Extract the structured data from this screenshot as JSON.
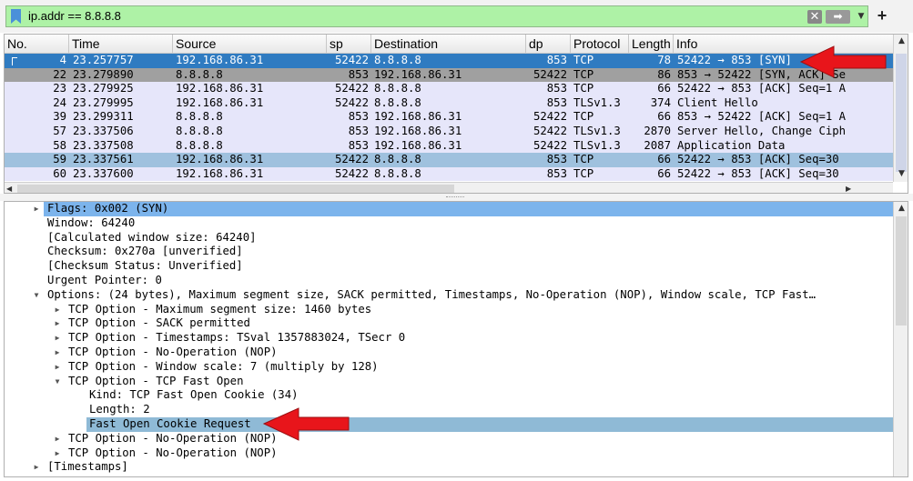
{
  "filter": {
    "value": "ip.addr == 8.8.8.8",
    "add_label": "+",
    "clear_glyph": "✕",
    "apply_glyph": "➡",
    "dropdown_glyph": "▼"
  },
  "packet_list": {
    "columns": [
      "No.",
      "Time",
      "Source",
      "sp",
      "Destination",
      "dp",
      "Protocol",
      "Length",
      "Info"
    ],
    "rows": [
      {
        "no": "4",
        "time": "23.257757",
        "source": "192.168.86.31",
        "sp": "52422",
        "destination": "8.8.8.8",
        "dp": "853",
        "protocol": "TCP",
        "length": "78",
        "info": "52422 → 853 [SYN]",
        "style": "selected"
      },
      {
        "no": "22",
        "time": "23.279890",
        "source": "8.8.8.8",
        "sp": "853",
        "destination": "192.168.86.31",
        "dp": "52422",
        "protocol": "TCP",
        "length": "86",
        "info": "853 → 52422 [SYN, ACK] Se",
        "style": "gray"
      },
      {
        "no": "23",
        "time": "23.279925",
        "source": "192.168.86.31",
        "sp": "52422",
        "destination": "8.8.8.8",
        "dp": "853",
        "protocol": "TCP",
        "length": "66",
        "info": "52422 → 853 [ACK] Seq=1 A",
        "style": "lavender"
      },
      {
        "no": "24",
        "time": "23.279995",
        "source": "192.168.86.31",
        "sp": "52422",
        "destination": "8.8.8.8",
        "dp": "853",
        "protocol": "TLSv1.3",
        "length": "374",
        "info": "Client Hello",
        "style": "lavender"
      },
      {
        "no": "39",
        "time": "23.299311",
        "source": "8.8.8.8",
        "sp": "853",
        "destination": "192.168.86.31",
        "dp": "52422",
        "protocol": "TCP",
        "length": "66",
        "info": "853 → 52422 [ACK] Seq=1 A",
        "style": "lavender"
      },
      {
        "no": "57",
        "time": "23.337506",
        "source": "8.8.8.8",
        "sp": "853",
        "destination": "192.168.86.31",
        "dp": "52422",
        "protocol": "TLSv1.3",
        "length": "2870",
        "info": "Server Hello, Change Ciph",
        "style": "lavender"
      },
      {
        "no": "58",
        "time": "23.337508",
        "source": "8.8.8.8",
        "sp": "853",
        "destination": "192.168.86.31",
        "dp": "52422",
        "protocol": "TLSv1.3",
        "length": "2087",
        "info": "Application Data",
        "style": "lavender"
      },
      {
        "no": "59",
        "time": "23.337561",
        "source": "192.168.86.31",
        "sp": "52422",
        "destination": "8.8.8.8",
        "dp": "853",
        "protocol": "TCP",
        "length": "66",
        "info": "52422 → 853 [ACK] Seq=30",
        "style": "blue"
      },
      {
        "no": "60",
        "time": "23.337600",
        "source": "192.168.86.31",
        "sp": "52422",
        "destination": "8.8.8.8",
        "dp": "853",
        "protocol": "TCP",
        "length": "66",
        "info": "52422 → 853 [ACK] Seq=30",
        "style": "lavender"
      }
    ]
  },
  "details": {
    "rows": [
      {
        "text": "Flags: 0x002 (SYN)",
        "level": 0,
        "caret": "collapsed",
        "style": "selected"
      },
      {
        "text": "Window: 64240",
        "level": 0,
        "caret": "none",
        "style": "normal"
      },
      {
        "text": "[Calculated window size: 64240]",
        "level": 0,
        "caret": "none",
        "style": "normal"
      },
      {
        "text": "Checksum: 0x270a [unverified]",
        "level": 0,
        "caret": "none",
        "style": "normal"
      },
      {
        "text": "[Checksum Status: Unverified]",
        "level": 0,
        "caret": "none",
        "style": "normal"
      },
      {
        "text": "Urgent Pointer: 0",
        "level": 0,
        "caret": "none",
        "style": "normal"
      },
      {
        "text": "Options: (24 bytes), Maximum segment size, SACK permitted, Timestamps, No-Operation (NOP), Window scale, TCP Fast…",
        "level": 0,
        "caret": "expanded",
        "style": "normal"
      },
      {
        "text": "TCP Option - Maximum segment size: 1460 bytes",
        "level": 1,
        "caret": "collapsed",
        "style": "normal"
      },
      {
        "text": "TCP Option - SACK permitted",
        "level": 1,
        "caret": "collapsed",
        "style": "normal"
      },
      {
        "text": "TCP Option - Timestamps: TSval 1357883024, TSecr 0",
        "level": 1,
        "caret": "collapsed",
        "style": "normal"
      },
      {
        "text": "TCP Option - No-Operation (NOP)",
        "level": 1,
        "caret": "collapsed",
        "style": "normal"
      },
      {
        "text": "TCP Option - Window scale: 7 (multiply by 128)",
        "level": 1,
        "caret": "collapsed",
        "style": "normal"
      },
      {
        "text": "TCP Option - TCP Fast Open",
        "level": 1,
        "caret": "expanded",
        "style": "normal"
      },
      {
        "text": "Kind: TCP Fast Open Cookie (34)",
        "level": 2,
        "caret": "none",
        "style": "normal"
      },
      {
        "text": "Length: 2",
        "level": 2,
        "caret": "none",
        "style": "normal"
      },
      {
        "text": "Fast Open Cookie Request",
        "level": 2,
        "caret": "none",
        "style": "highlight"
      },
      {
        "text": "TCP Option - No-Operation (NOP)",
        "level": 1,
        "caret": "collapsed",
        "style": "normal"
      },
      {
        "text": "TCP Option - No-Operation (NOP)",
        "level": 1,
        "caret": "collapsed",
        "style": "normal"
      },
      {
        "text": "[Timestamps]",
        "level": 0,
        "caret": "collapsed",
        "style": "normal"
      }
    ]
  },
  "colors": {
    "filter_valid": "#aef2a6",
    "row_selected": "#2f7bc1",
    "row_gray": "#a0a0a0",
    "row_lavender": "#e6e6fa",
    "row_blue": "#9fc1de",
    "detail_selected": "#7cb4ec",
    "detail_highlight": "#8fbad6",
    "arrow_red": "#e8151b"
  }
}
